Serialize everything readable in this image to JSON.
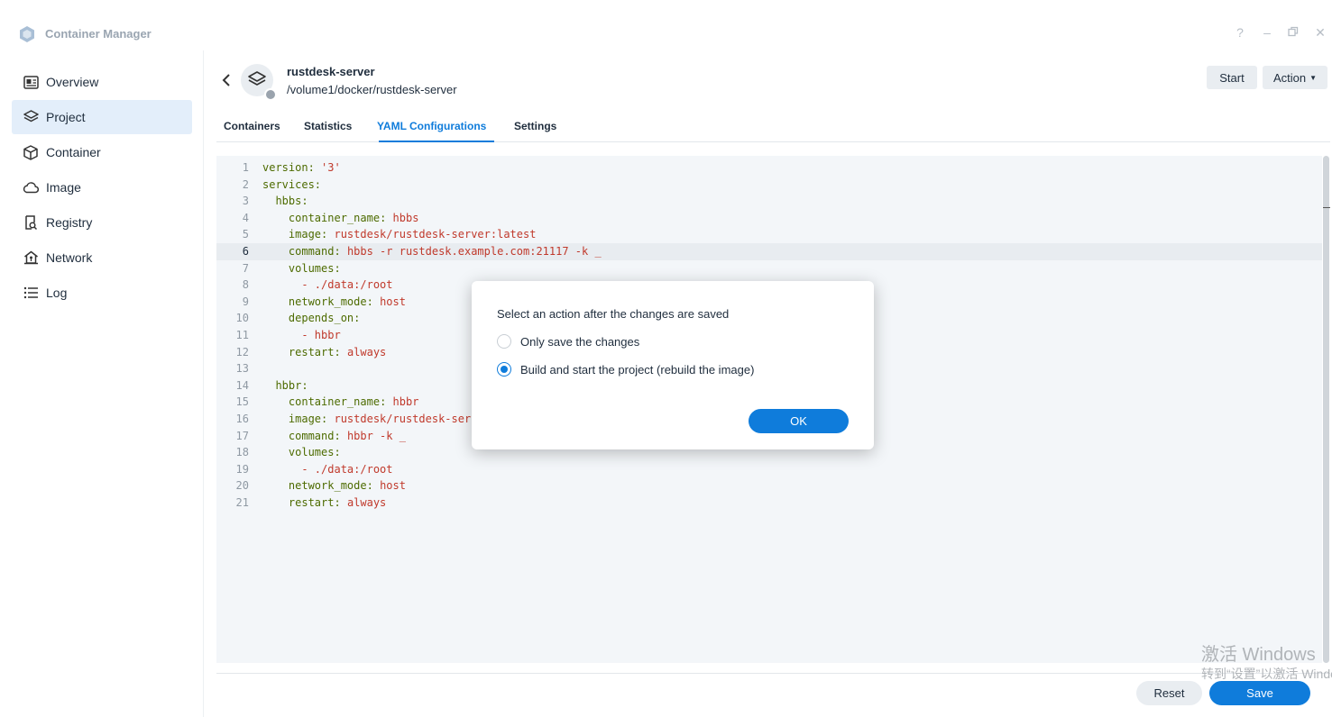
{
  "app": {
    "title": "Container Manager",
    "window_controls": [
      "?",
      "–",
      "🗗",
      "✕"
    ]
  },
  "sidebar": {
    "items": [
      {
        "label": "Overview",
        "icon": "overview-icon",
        "active": false
      },
      {
        "label": "Project",
        "icon": "project-layers-icon",
        "active": true
      },
      {
        "label": "Container",
        "icon": "container-cube-icon",
        "active": false
      },
      {
        "label": "Image",
        "icon": "image-cloud-icon",
        "active": false
      },
      {
        "label": "Registry",
        "icon": "registry-search-icon",
        "active": false
      },
      {
        "label": "Network",
        "icon": "network-house-icon",
        "active": false
      },
      {
        "label": "Log",
        "icon": "log-list-icon",
        "active": false
      }
    ]
  },
  "header": {
    "name": "rustdesk-server",
    "path": "/volume1/docker/rustdesk-server",
    "start_label": "Start",
    "action_label": "Action"
  },
  "tabs": [
    {
      "label": "Containers",
      "active": false
    },
    {
      "label": "Statistics",
      "active": false
    },
    {
      "label": "YAML Configurations",
      "active": true
    },
    {
      "label": "Settings",
      "active": false
    }
  ],
  "editor": {
    "highlighted_line": 6,
    "lines": [
      {
        "n": "1",
        "indent": "",
        "key": "version",
        "value": "'3'"
      },
      {
        "n": "2",
        "indent": "",
        "key": "services",
        "value": ""
      },
      {
        "n": "3",
        "indent": "  ",
        "key": "hbbs",
        "value": ""
      },
      {
        "n": "4",
        "indent": "    ",
        "key": "container_name",
        "value": "hbbs"
      },
      {
        "n": "5",
        "indent": "    ",
        "key": "image",
        "value": "rustdesk/rustdesk-server:latest"
      },
      {
        "n": "6",
        "indent": "    ",
        "key": "command",
        "value": "hbbs -r rustdesk.example.com:21117 -k _"
      },
      {
        "n": "7",
        "indent": "    ",
        "key": "volumes",
        "value": ""
      },
      {
        "n": "8",
        "indent": "      ",
        "key": "",
        "value": "- ./data:/root"
      },
      {
        "n": "9",
        "indent": "    ",
        "key": "network_mode",
        "value": "host"
      },
      {
        "n": "10",
        "indent": "    ",
        "key": "depends_on",
        "value": ""
      },
      {
        "n": "11",
        "indent": "      ",
        "key": "",
        "value": "- hbbr"
      },
      {
        "n": "12",
        "indent": "    ",
        "key": "restart",
        "value": "always"
      },
      {
        "n": "13",
        "indent": "",
        "key": "",
        "value": ""
      },
      {
        "n": "14",
        "indent": "  ",
        "key": "hbbr",
        "value": ""
      },
      {
        "n": "15",
        "indent": "    ",
        "key": "container_name",
        "value": "hbbr"
      },
      {
        "n": "16",
        "indent": "    ",
        "key": "image",
        "value": "rustdesk/rustdesk-server:latest"
      },
      {
        "n": "17",
        "indent": "    ",
        "key": "command",
        "value": "hbbr -k _"
      },
      {
        "n": "18",
        "indent": "    ",
        "key": "volumes",
        "value": ""
      },
      {
        "n": "19",
        "indent": "      ",
        "key": "",
        "value": "- ./data:/root"
      },
      {
        "n": "20",
        "indent": "    ",
        "key": "network_mode",
        "value": "host"
      },
      {
        "n": "21",
        "indent": "    ",
        "key": "restart",
        "value": "always"
      }
    ]
  },
  "footer": {
    "reset_label": "Reset",
    "save_label": "Save"
  },
  "dialog": {
    "title": "Select an action after the changes are saved",
    "options": [
      {
        "label": "Only save the changes",
        "checked": false
      },
      {
        "label": "Build and start the project (rebuild the image)",
        "checked": true
      }
    ],
    "ok_label": "OK"
  },
  "watermark": {
    "line1": "激活 Windows",
    "line2": "转到“设置”以激活 Windows。"
  },
  "colors": {
    "accent": "#0f7cdb",
    "active_nav_bg": "#e3eefa",
    "editor_bg": "#f3f6f9"
  }
}
